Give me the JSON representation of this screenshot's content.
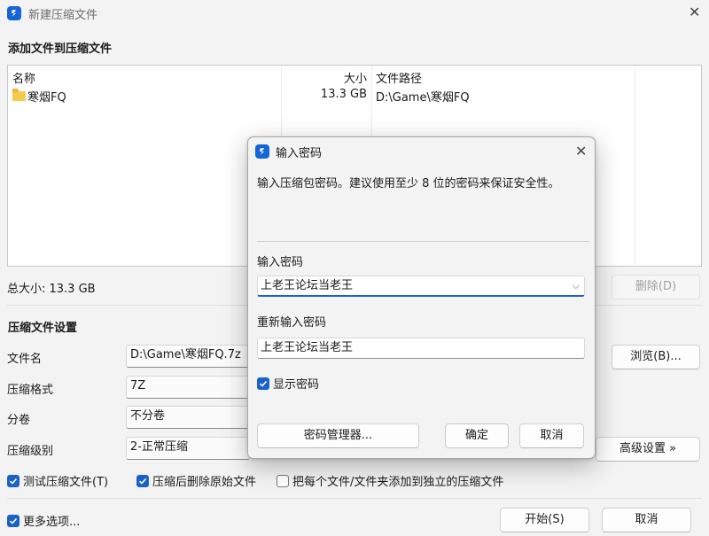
{
  "main": {
    "title": "新建压缩文件",
    "add_files_heading": "添加文件到压缩文件",
    "columns": {
      "name": "名称",
      "size": "大小",
      "path": "文件路径"
    },
    "files": [
      {
        "name": "寒烟FQ",
        "size": "13.3 GB",
        "path": "D:\\Game\\寒烟FQ"
      }
    ],
    "total_size": "总大小: 13.3 GB",
    "delete_button": "删除(D)",
    "settings_heading": "压缩文件设置",
    "filename_label": "文件名",
    "filename_value": "D:\\Game\\寒烟FQ.7z",
    "browse_button": "浏览(B)...",
    "format_label": "压缩格式",
    "format_value": "7Z",
    "volume_label": "分卷",
    "volume_value": "不分卷",
    "level_label": "压缩级别",
    "level_value": "2-正常压缩",
    "advanced_button": "高级设置 »",
    "test_archive": {
      "label": "测试压缩文件(T)",
      "checked": true
    },
    "delete_after": {
      "label": "压缩后删除原始文件",
      "checked": true
    },
    "separate_archives": {
      "label": "把每个文件/文件夹添加到独立的压缩文件",
      "checked": false
    },
    "more_options": {
      "label": "更多选项...",
      "checked": true
    },
    "start_button": "开始(S)",
    "cancel_button": "取消"
  },
  "dialog": {
    "title": "输入密码",
    "message": "输入压缩包密码。建议使用至少 8 位的密码来保证安全性。",
    "password_label": "输入密码",
    "password_value": "上老王论坛当老王",
    "confirm_label": "重新输入密码",
    "confirm_value": "上老王论坛当老王",
    "show_password": {
      "label": "显示密码",
      "checked": true
    },
    "manager_button": "密码管理器...",
    "ok_button": "确定",
    "cancel_button": "取消"
  },
  "colors": {
    "accent": "#1a62c9",
    "app_icon": "#1565d8",
    "folder": "#f7c94b"
  }
}
